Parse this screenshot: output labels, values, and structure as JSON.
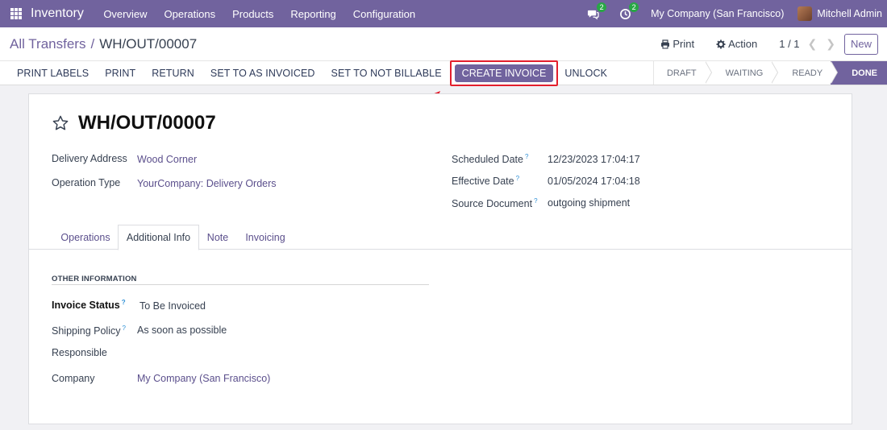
{
  "navbar": {
    "brand": "Inventory",
    "menu": [
      "Overview",
      "Operations",
      "Products",
      "Reporting",
      "Configuration"
    ],
    "messages_count": "2",
    "activities_count": "2",
    "company": "My Company (San Francisco)",
    "user": "Mitchell Admin"
  },
  "control_panel": {
    "breadcrumb_parent": "All Transfers",
    "breadcrumb_separator": "/",
    "breadcrumb_current": "WH/OUT/00007",
    "print_label": "Print",
    "action_label": "Action",
    "pager": "1 / 1",
    "new_label": "New"
  },
  "actions": {
    "print_labels": "PRINT LABELS",
    "print": "PRINT",
    "return": "RETURN",
    "set_invoiced": "SET TO AS INVOICED",
    "set_not_billable": "SET TO NOT BILLABLE",
    "create_invoice": "CREATE INVOICE",
    "unlock": "UNLOCK"
  },
  "stages": [
    {
      "label": "DRAFT",
      "active": false
    },
    {
      "label": "WAITING",
      "active": false
    },
    {
      "label": "READY",
      "active": false
    },
    {
      "label": "DONE",
      "active": true
    }
  ],
  "record": {
    "title": "WH/OUT/00007",
    "delivery_address_label": "Delivery Address",
    "delivery_address": "Wood Corner",
    "operation_type_label": "Operation Type",
    "operation_type": "YourCompany: Delivery Orders",
    "scheduled_date_label": "Scheduled Date",
    "scheduled_date": "12/23/2023 17:04:17",
    "effective_date_label": "Effective Date",
    "effective_date": "01/05/2024 17:04:18",
    "source_document_label": "Source Document",
    "source_document": "outgoing shipment",
    "help_mark": "?"
  },
  "tabs": [
    "Operations",
    "Additional Info",
    "Note",
    "Invoicing"
  ],
  "active_tab": "Additional Info",
  "other_info": {
    "section_title": "OTHER INFORMATION",
    "invoice_status_label": "Invoice Status",
    "invoice_status": "To Be Invoiced",
    "shipping_policy_label": "Shipping Policy",
    "shipping_policy": "As soon as possible",
    "responsible_label": "Responsible",
    "responsible": "",
    "company_label": "Company",
    "company": "My Company (San Francisco)"
  },
  "colors": {
    "brand": "#71639e",
    "highlight": "#e31e2c",
    "badge": "#28a745"
  },
  "icons": [
    "apps-grid-icon",
    "chat-icon",
    "clock-icon",
    "print-icon",
    "gear-icon",
    "star-icon",
    "chevron-left-icon",
    "chevron-right-icon"
  ]
}
